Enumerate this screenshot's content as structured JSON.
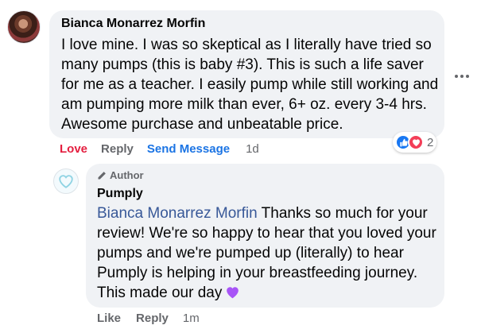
{
  "comment": {
    "author": "Bianca Monarrez Morfin",
    "text": "I love mine. I was so skeptical as I literally have tried so many pumps (this is baby #3). This is such a life saver for me as a teacher. I easily pump while still working and am pumping more milk than ever, 6+ oz. every 3-4 hrs. Awesome purchase and unbeatable price.",
    "actions": {
      "love": "Love",
      "reply": "Reply",
      "send_message": "Send Message",
      "time": "1d"
    },
    "reactions": {
      "count": "2",
      "types": [
        "like-icon",
        "love-icon"
      ]
    },
    "colors": {
      "love": "#e41e3f",
      "send": "#1b74e4",
      "bubble": "#f0f2f5"
    }
  },
  "reply": {
    "badge": "Author",
    "author": "Pumply",
    "mention": "Bianca Monarrez Morfin",
    "text": "Thanks so much for your review! We're so happy to hear that you loved your pumps and we're pumped up (literally) to hear Pumply is helping in your breastfeeding journey. This made our day",
    "emoji": "purple-heart-icon",
    "actions": {
      "like": "Like",
      "reply": "Reply",
      "time": "1m"
    }
  }
}
